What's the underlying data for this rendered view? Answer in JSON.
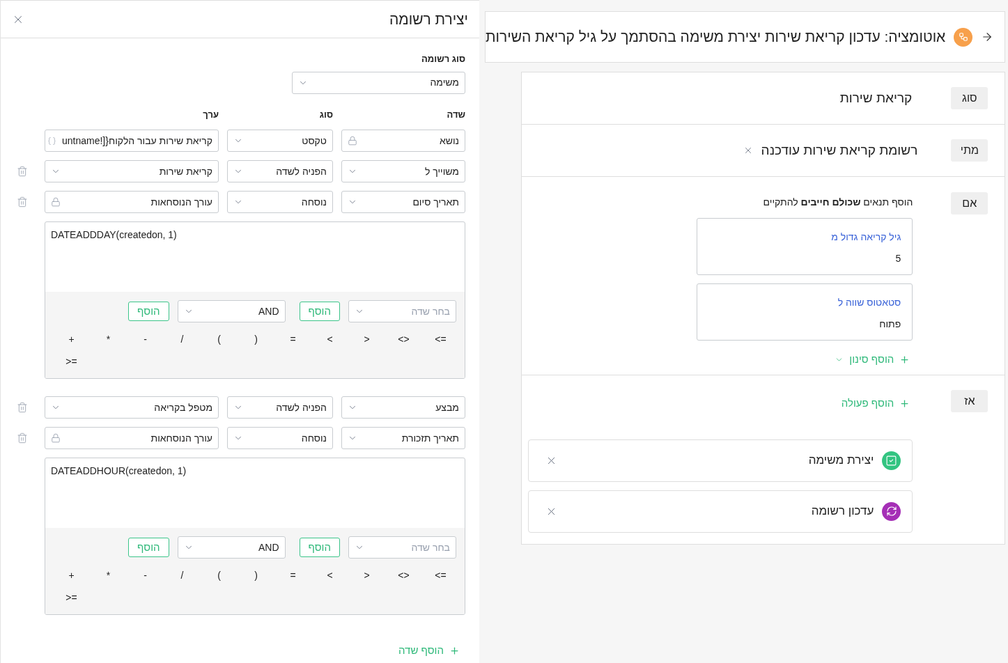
{
  "record_panel": {
    "title": "יצירת רשומה",
    "record_type": {
      "label": "סוג רשומה",
      "value": "משימה"
    },
    "columns": [
      "שדה",
      "סוג",
      "ערך"
    ],
    "rows": [
      {
        "field": "נושא",
        "field_locked": true,
        "type": "טקסט",
        "value": "קריאת שירות עבור הלקוח{[!untname",
        "kind": "text",
        "deletable": false
      },
      {
        "field": "משוייך ל",
        "field_locked": false,
        "type": "הפניה לשדה",
        "value": "קריאת שירות",
        "kind": "select",
        "deletable": true
      },
      {
        "field": "תאריך סיום",
        "field_locked": false,
        "type": "נוסחה",
        "value": "עורך הנוסחאות",
        "kind": "locked",
        "deletable": true,
        "formula": {
          "text": "DATEADDDAY(createdon, 1)",
          "field_placeholder": "בחר שדה",
          "add_field_label": "הוסף",
          "logic_value": "AND",
          "add_logic_label": "הוסף",
          "operators": [
            "<=",
            "<>",
            ">",
            "<",
            "=",
            ")",
            "(",
            "/",
            "-",
            "*",
            "+",
            ">="
          ]
        }
      },
      {
        "field": "מבצע",
        "field_locked": false,
        "type": "הפניה לשדה",
        "value": "מטפל בקריאה",
        "kind": "select",
        "deletable": true
      },
      {
        "field": "תאריך תזכורת",
        "field_locked": false,
        "type": "נוסחה",
        "value": "עורך הנוסחאות",
        "kind": "locked",
        "deletable": true,
        "formula": {
          "text": "DATEADDHOUR(createdon, 1)",
          "field_placeholder": "בחר שדה",
          "add_field_label": "הוסף",
          "logic_value": "AND",
          "add_logic_label": "הוסף",
          "operators": [
            "<=",
            "<>",
            ">",
            "<",
            "=",
            ")",
            "(",
            "/",
            "-",
            "*",
            "+",
            ">="
          ]
        }
      }
    ],
    "add_field": "הוסף שדה"
  },
  "automation": {
    "title": "אוטומציה: עדכון קריאת שירות יצירת משימה בהסתמך על גיל קריאת השירות",
    "type_section": {
      "tag": "סוג",
      "value": "קריאת שירות"
    },
    "when_section": {
      "tag": "מתי",
      "value": "רשומת קריאת שירות עודכנה"
    },
    "if_section": {
      "tag": "אם",
      "hint": "הוסף תנאים **שכולם חייבים** להתקיים",
      "conditions": [
        {
          "label": "גיל קריאה גדול מ",
          "value": "5"
        },
        {
          "label": "סטאטוס שווה ל",
          "value": "פתוח"
        }
      ],
      "add_filter": "הוסף סינון"
    },
    "then_section": {
      "tag": "אז",
      "add_action": "הוסף פעולה",
      "actions": [
        {
          "kind": "create_task",
          "label": "יצירת משימה",
          "color": "#33c481"
        },
        {
          "kind": "update_record",
          "label": "עדכון רשומה",
          "color": "#a52fb6"
        }
      ]
    }
  }
}
